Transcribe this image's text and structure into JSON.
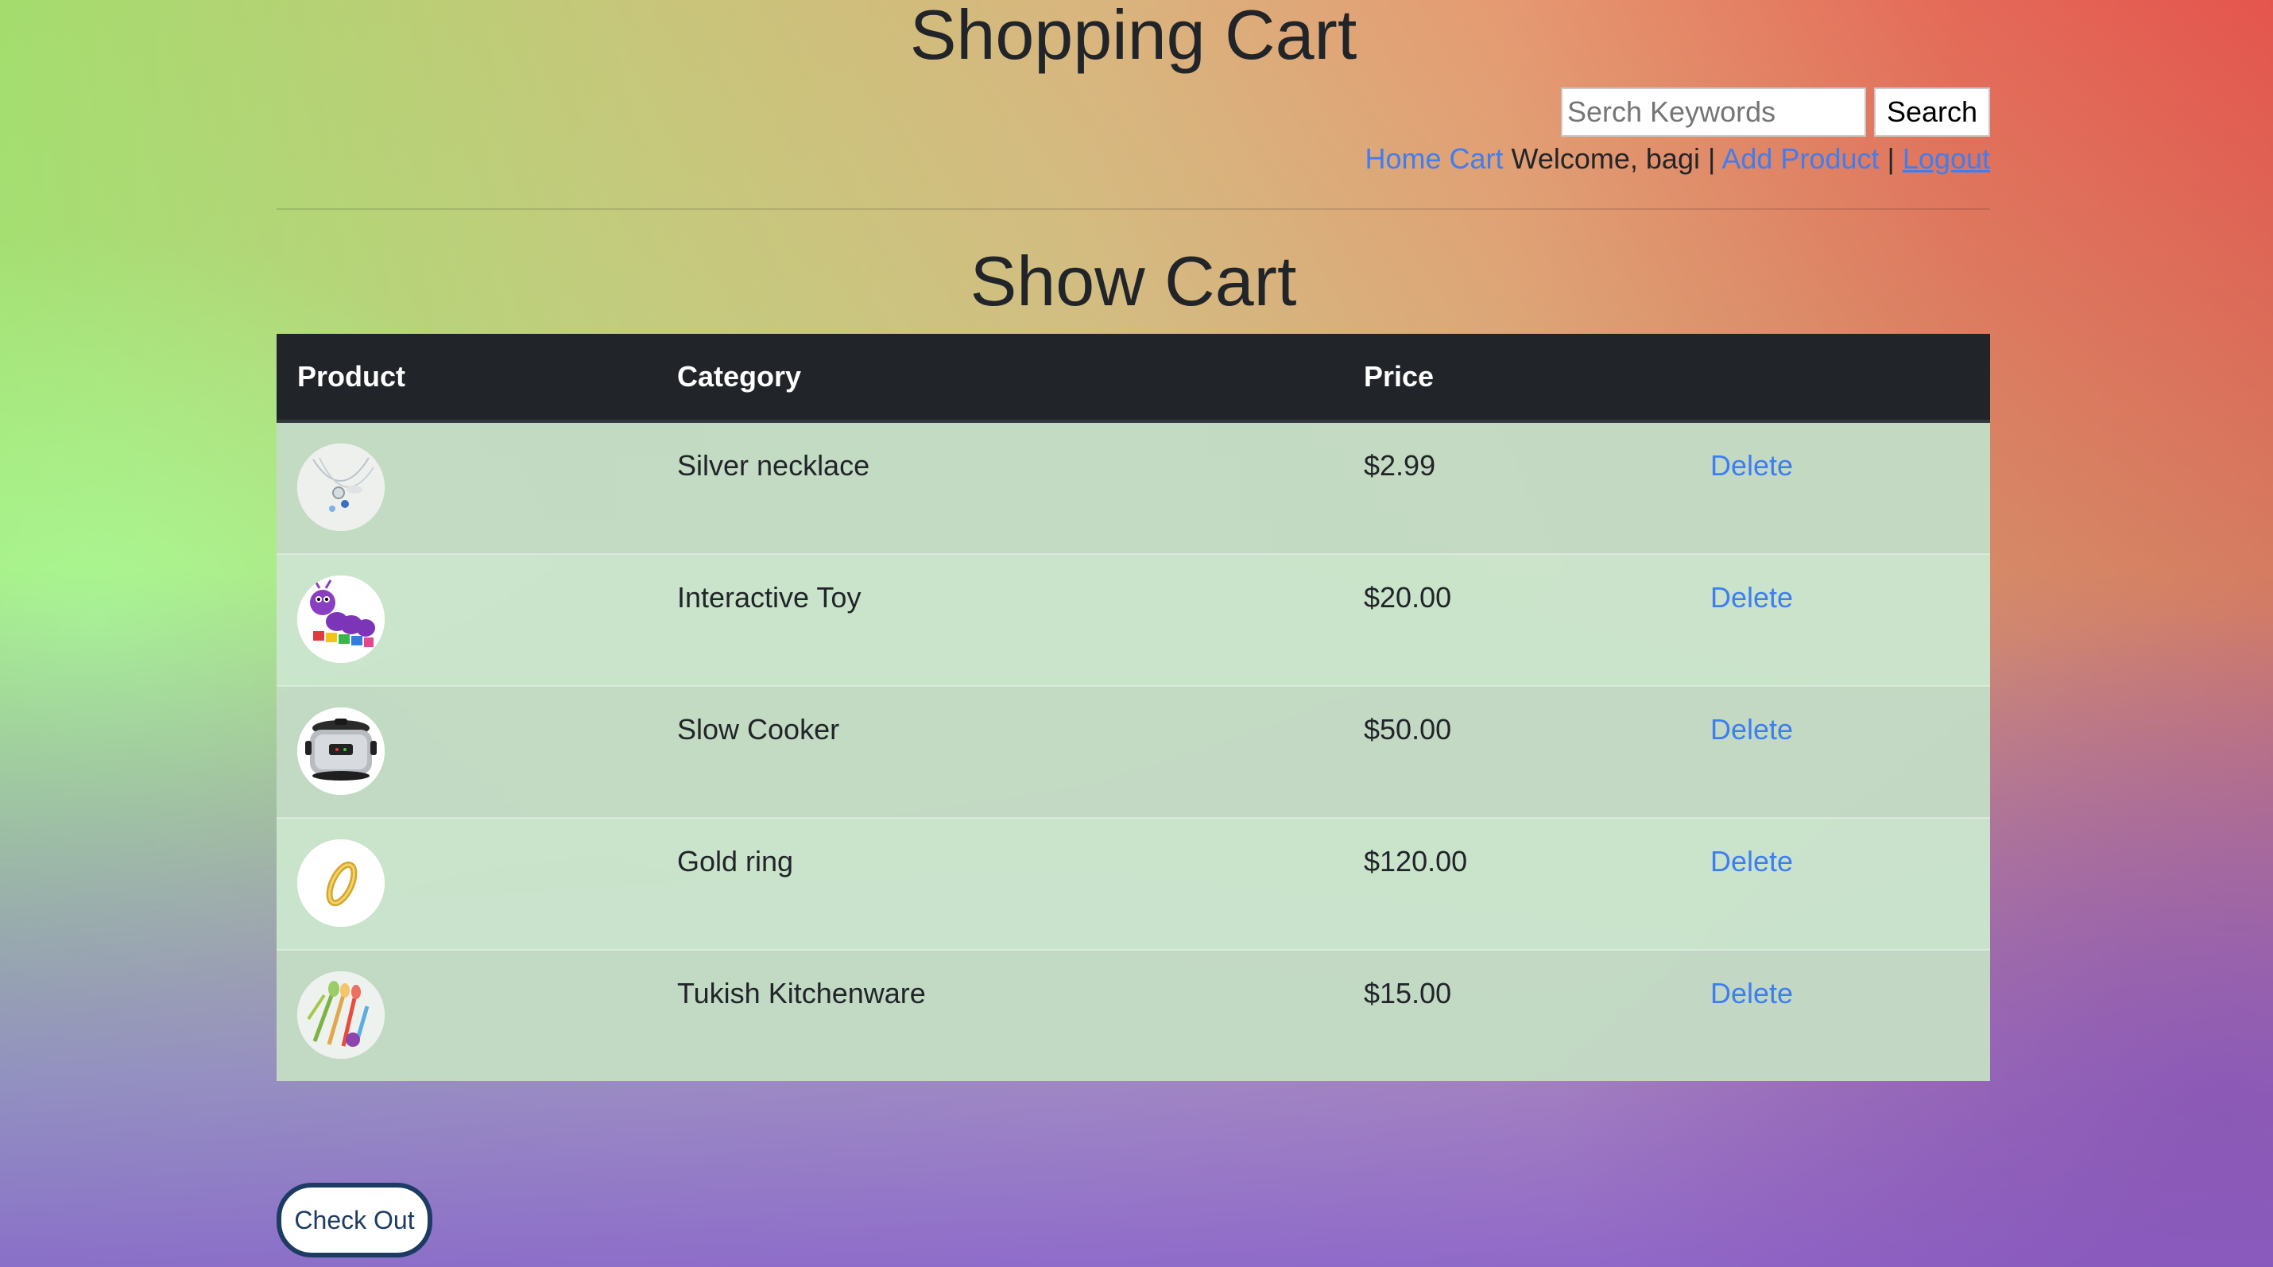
{
  "header": {
    "site_title": "Shopping Cart",
    "search": {
      "placeholder": "Serch Keywords",
      "value": "",
      "button_label": "Search"
    },
    "nav": {
      "home_label": "Home",
      "cart_label": "Cart",
      "welcome_text": "Welcome, bagi",
      "separator": "|",
      "add_product_label": "Add Product",
      "logout_label": "Logout"
    }
  },
  "main": {
    "section_title": "Show Cart",
    "table": {
      "columns": [
        "Product",
        "Category",
        "Price",
        ""
      ],
      "rows": [
        {
          "image_icon": "necklace-image",
          "category": "Silver necklace",
          "price": "$2.99",
          "action_label": "Delete"
        },
        {
          "image_icon": "toy-caterpillar-image",
          "category": "Interactive Toy",
          "price": "$20.00",
          "action_label": "Delete"
        },
        {
          "image_icon": "slow-cooker-image",
          "category": "Slow Cooker",
          "price": "$50.00",
          "action_label": "Delete"
        },
        {
          "image_icon": "gold-ring-image",
          "category": "Gold ring",
          "price": "$120.00",
          "action_label": "Delete"
        },
        {
          "image_icon": "kitchen-utensils-image",
          "category": "Tukish Kitchenware",
          "price": "$15.00",
          "action_label": "Delete"
        }
      ]
    },
    "checkout_label": "Check Out"
  },
  "colors": {
    "link": "#3d7ef2",
    "table_header_bg": "#212529",
    "checkout_border": "#1d3c63"
  }
}
